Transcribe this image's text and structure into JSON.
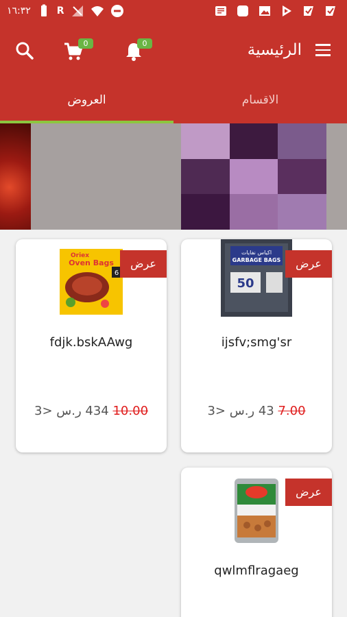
{
  "status_bar": {
    "time": "١٦:٣٢",
    "carrier": "R"
  },
  "header": {
    "title": "الرئيسية",
    "cart_count": "0",
    "notification_count": "0"
  },
  "tabs": {
    "offers": "العروض",
    "categories": "الاقسام",
    "active": "offers"
  },
  "banner": {
    "grid_colors": [
      "#c09ac6",
      "#3d1a3f",
      "#7b5b8c",
      "#4f2a53",
      "#b88bc2",
      "#5a2f5e",
      "#3c1740",
      "#9a6ea4",
      "#a07bb0"
    ]
  },
  "products": [
    {
      "name": "ijsfv;smg'sr",
      "offer_label": "عرض",
      "old_price": "7.00",
      "new_price": "43",
      "currency": "ر.س",
      "suffix": "<3",
      "image": "garbage-bags"
    },
    {
      "name": "fdjk.bskAAwg",
      "offer_label": "عرض",
      "old_price": "10.00",
      "new_price": "434",
      "currency": "ر.س",
      "suffix": "<3",
      "image": "oven-bags"
    },
    {
      "name": "qwlmflragaeg",
      "offer_label": "عرض",
      "image": "beans-can"
    }
  ],
  "product_images": {
    "garbage_bags_title": "GARBAGE BAGS",
    "garbage_bags_ar": "اكياس نفايات",
    "garbage_bags_size": "50",
    "oven_bags_brand": "Oriex",
    "oven_bags_title": "Oven Bags",
    "oven_bags_count": "6"
  }
}
